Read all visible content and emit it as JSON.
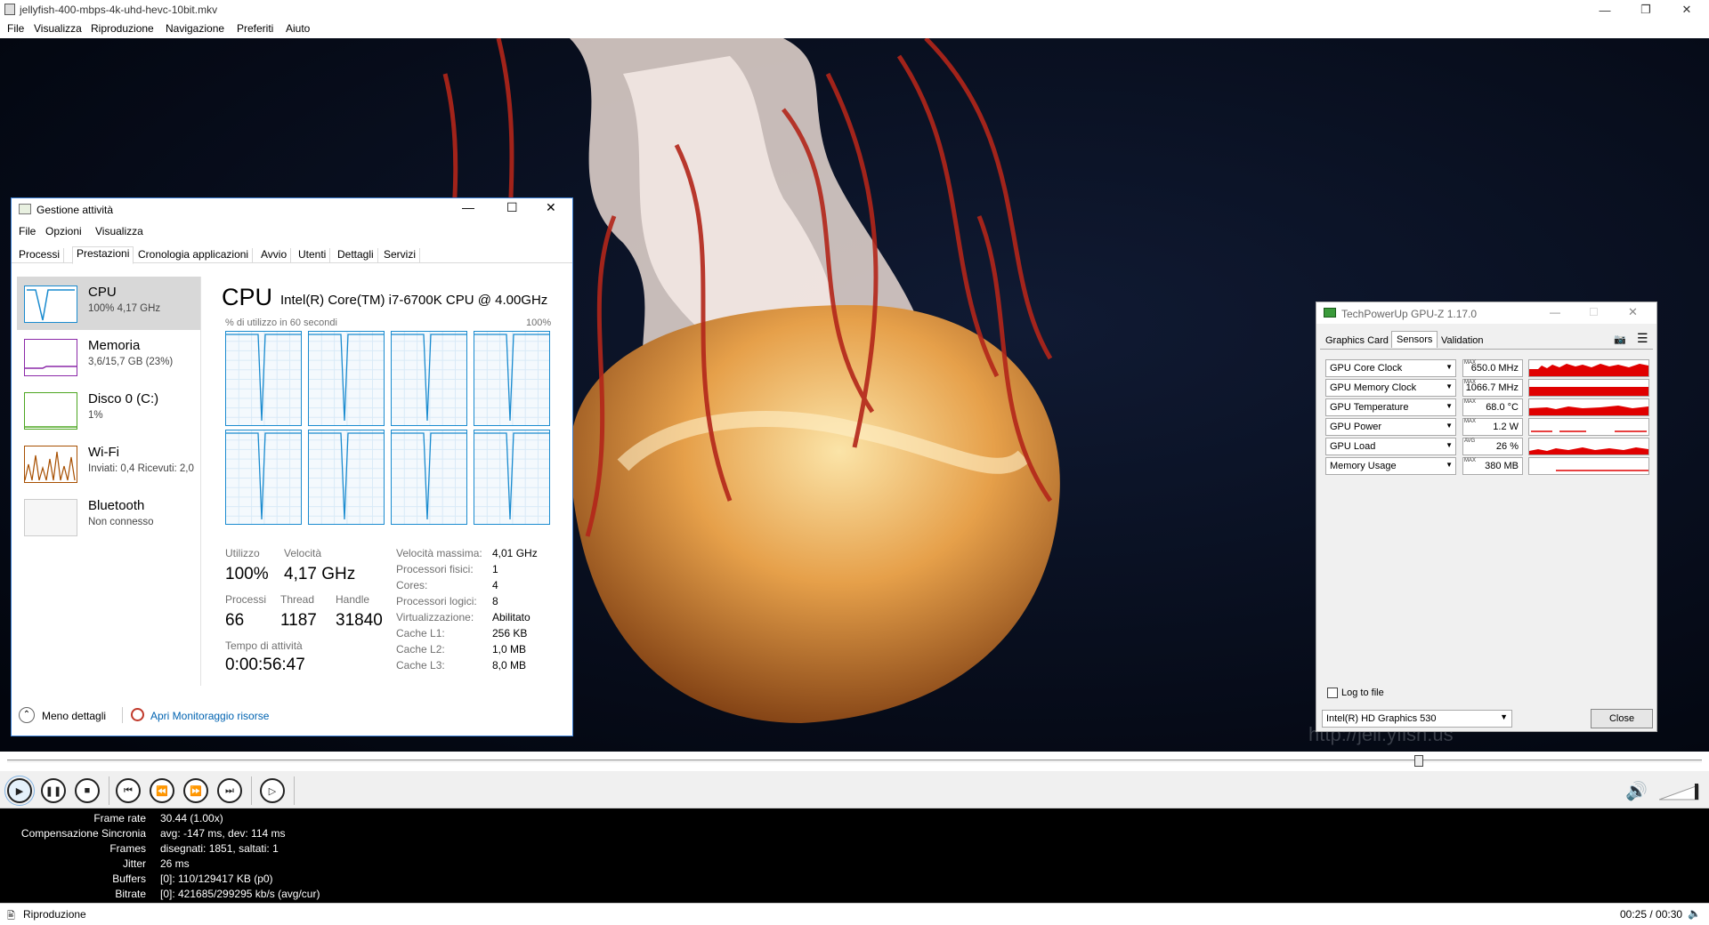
{
  "player": {
    "title": "jellyfish-400-mbps-4k-uhd-hevc-10bit.mkv",
    "menu": [
      "File",
      "Visualizza",
      "Riproduzione",
      "Navigazione",
      "Preferiti",
      "Aiuto"
    ],
    "watermark": "http://jell.yfish.us",
    "seek_fraction": 0.833,
    "stats": [
      {
        "k": "Frame rate",
        "v": "30.44 (1.00x)"
      },
      {
        "k": "Compensazione Sincronia",
        "v": "avg: -147 ms, dev: 114 ms"
      },
      {
        "k": "Frames",
        "v": "disegnati: 1851, saltati: 1"
      },
      {
        "k": "Jitter",
        "v": "26 ms"
      },
      {
        "k": "Buffers",
        "v": "[0]: 110/129417 KB (p0)"
      },
      {
        "k": "Bitrate",
        "v": "[0]: 421685/299295 kb/s (avg/cur)"
      }
    ],
    "status": "Riproduzione",
    "time": "00:25 / 00:30"
  },
  "taskmgr": {
    "title": "Gestione attività",
    "menu": [
      "File",
      "Opzioni",
      "Visualizza"
    ],
    "tabs": [
      "Processi",
      "Prestazioni",
      "Cronologia applicazioni",
      "Avvio",
      "Utenti",
      "Dettagli",
      "Servizi"
    ],
    "side": [
      {
        "name": "CPU",
        "sub": "100% 4,17 GHz"
      },
      {
        "name": "Memoria",
        "sub": "3,6/15,7 GB (23%)"
      },
      {
        "name": "Disco 0 (C:)",
        "sub": "1%"
      },
      {
        "name": "Wi-Fi",
        "sub": "Inviati: 0,4 Ricevuti: 2,0"
      },
      {
        "name": "Bluetooth",
        "sub": "Non connesso"
      }
    ],
    "heading": "CPU",
    "cpu_model": "Intel(R) Core(TM) i7-6700K CPU @ 4.00GHz",
    "graph_label": "% di utilizzo in 60 secondi",
    "graph_max": "100%",
    "utilizzo_lbl": "Utilizzo",
    "utilizzo": "100%",
    "velocita_lbl": "Velocità",
    "velocita": "4,17 GHz",
    "processi_lbl": "Processi",
    "processi": "66",
    "thread_lbl": "Thread",
    "thread": "1187",
    "handle_lbl": "Handle",
    "handle": "31840",
    "uptime_lbl": "Tempo di attività",
    "uptime": "0:00:56:47",
    "specs": [
      {
        "k": "Velocità massima:",
        "v": "4,01 GHz"
      },
      {
        "k": "Processori fisici:",
        "v": "1"
      },
      {
        "k": "Cores:",
        "v": "4"
      },
      {
        "k": "Processori logici:",
        "v": "8"
      },
      {
        "k": "Virtualizzazione:",
        "v": "Abilitato"
      },
      {
        "k": "Cache L1:",
        "v": "256 KB"
      },
      {
        "k": "Cache L2:",
        "v": "1,0 MB"
      },
      {
        "k": "Cache L3:",
        "v": "8,0 MB"
      }
    ],
    "less_details": "Meno dettagli",
    "resmon": "Apri Monitoraggio risorse"
  },
  "gpuz": {
    "title": "TechPowerUp GPU-Z 1.17.0",
    "tabs": [
      "Graphics Card",
      "Sensors",
      "Validation"
    ],
    "sensors": [
      {
        "name": "GPU Core Clock",
        "tag": "MAX",
        "value": "650.0 MHz"
      },
      {
        "name": "GPU Memory Clock",
        "tag": "MAX",
        "value": "1066.7 MHz"
      },
      {
        "name": "GPU Temperature",
        "tag": "MAX",
        "value": "68.0 °C"
      },
      {
        "name": "GPU Power",
        "tag": "MAX",
        "value": "1.2 W"
      },
      {
        "name": "GPU Load",
        "tag": "AVG",
        "value": "26 %"
      },
      {
        "name": "Memory Usage",
        "tag": "MAX",
        "value": "380 MB"
      }
    ],
    "log_label": "Log to file",
    "gpu_select": "Intel(R) HD Graphics 530",
    "close": "Close"
  }
}
